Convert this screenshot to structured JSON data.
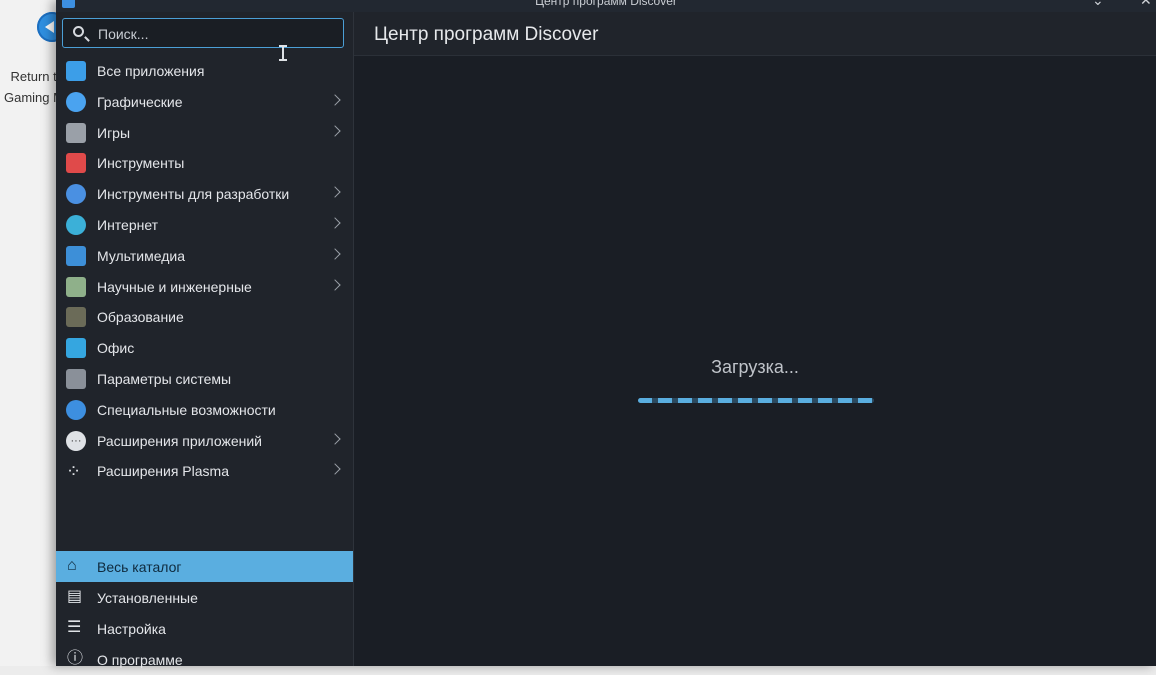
{
  "desktop": {
    "icon_label_line1": "Return to",
    "icon_label_line2": "Gaming Mode"
  },
  "window": {
    "title": "Центр программ Discover",
    "header_title": "Центр программ Discover"
  },
  "search": {
    "placeholder": "Поиск..."
  },
  "categories": [
    {
      "label": "Все приложения",
      "icon": "apps-grid-icon",
      "color": "#3c9ee8",
      "submenu": false
    },
    {
      "label": "Графические",
      "icon": "graphics-icon",
      "color": "#4aa3f0",
      "submenu": true
    },
    {
      "label": "Игры",
      "icon": "gamepad-icon",
      "color": "#9aa0a8",
      "submenu": true
    },
    {
      "label": "Инструменты",
      "icon": "toolbox-icon",
      "color": "#e04a4a",
      "submenu": false
    },
    {
      "label": "Инструменты для разработки",
      "icon": "dev-tools-icon",
      "color": "#4a90e2",
      "submenu": true
    },
    {
      "label": "Интернет",
      "icon": "globe-icon",
      "color": "#3bb0d8",
      "submenu": true
    },
    {
      "label": "Мультимедиа",
      "icon": "multimedia-icon",
      "color": "#3d8fd8",
      "submenu": true
    },
    {
      "label": "Научные и инженерные",
      "icon": "science-icon",
      "color": "#8fb08a",
      "submenu": true
    },
    {
      "label": "Образование",
      "icon": "education-icon",
      "color": "#6b6b58",
      "submenu": false
    },
    {
      "label": "Офис",
      "icon": "office-icon",
      "color": "#35a6e0",
      "submenu": false
    },
    {
      "label": "Параметры системы",
      "icon": "system-settings-icon",
      "color": "#8a9099",
      "submenu": false
    },
    {
      "label": "Специальные возможности",
      "icon": "accessibility-icon",
      "color": "#3d8fe0",
      "submenu": false
    },
    {
      "label": "Расширения приложений",
      "icon": "app-addons-icon",
      "color": "#dfe2e6",
      "submenu": true
    },
    {
      "label": "Расширения Plasma",
      "icon": "plasma-addons-icon",
      "color": "#dfe2e6",
      "submenu": true
    }
  ],
  "nav": [
    {
      "label": "Весь каталог",
      "icon": "home-icon",
      "active": true
    },
    {
      "label": "Установленные",
      "icon": "installed-icon",
      "active": false
    },
    {
      "label": "Настройка",
      "icon": "settings-sliders-icon",
      "active": false
    },
    {
      "label": "О программе",
      "icon": "info-icon",
      "active": false
    }
  ],
  "main": {
    "loading_text": "Загрузка..."
  }
}
